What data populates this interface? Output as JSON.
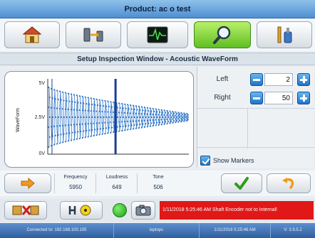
{
  "header": {
    "product_title": "Product: ac o test"
  },
  "nav": {
    "buttons": [
      {
        "icon": "home-icon"
      },
      {
        "icon": "transfer-icon"
      },
      {
        "icon": "waveform-icon"
      },
      {
        "icon": "magnifier-icon",
        "active": true
      },
      {
        "icon": "tools-icon"
      }
    ]
  },
  "window": {
    "title": "Setup Inspection Window - Acoustic WaveForm"
  },
  "chart_data": {
    "type": "scatter",
    "ylabel": "WaveForm",
    "ytick_labels": [
      "5V",
      "2.5V",
      "0V"
    ],
    "ylim": [
      0,
      5
    ],
    "center": 2.5,
    "marker_count": 50,
    "left_marker_index": 2,
    "right_marker_index": 50,
    "amplitude_start": 2.1,
    "amplitude_end": 0.25
  },
  "settings": {
    "left": {
      "label": "Left",
      "value": "2"
    },
    "right": {
      "label": "Right",
      "value": "50"
    },
    "show_markers": {
      "label": "Show Markers",
      "checked": true
    }
  },
  "metrics": {
    "frequency": {
      "label": "Frequency",
      "value": "5950"
    },
    "loudness": {
      "label": "Loudness",
      "value": "649"
    },
    "tone": {
      "label": "Tone",
      "value": "506"
    }
  },
  "tools": {
    "alarm_text": "1/11/2018 5:25:46 AM Shaft Encoder not to Internal!"
  },
  "status_bar": {
    "connection": "Connected to: 192.168.100.105",
    "host": "laptops",
    "datetime": "1/11/2018 5:25:46 AM",
    "version": "V: 3.9.5.2"
  },
  "colors": {
    "accent_blue": "#1f74c7",
    "active_green": "#5fbf22",
    "alarm_red": "#e01818",
    "waveform": "#2f76c9",
    "marker_line": "#1c3f93"
  }
}
